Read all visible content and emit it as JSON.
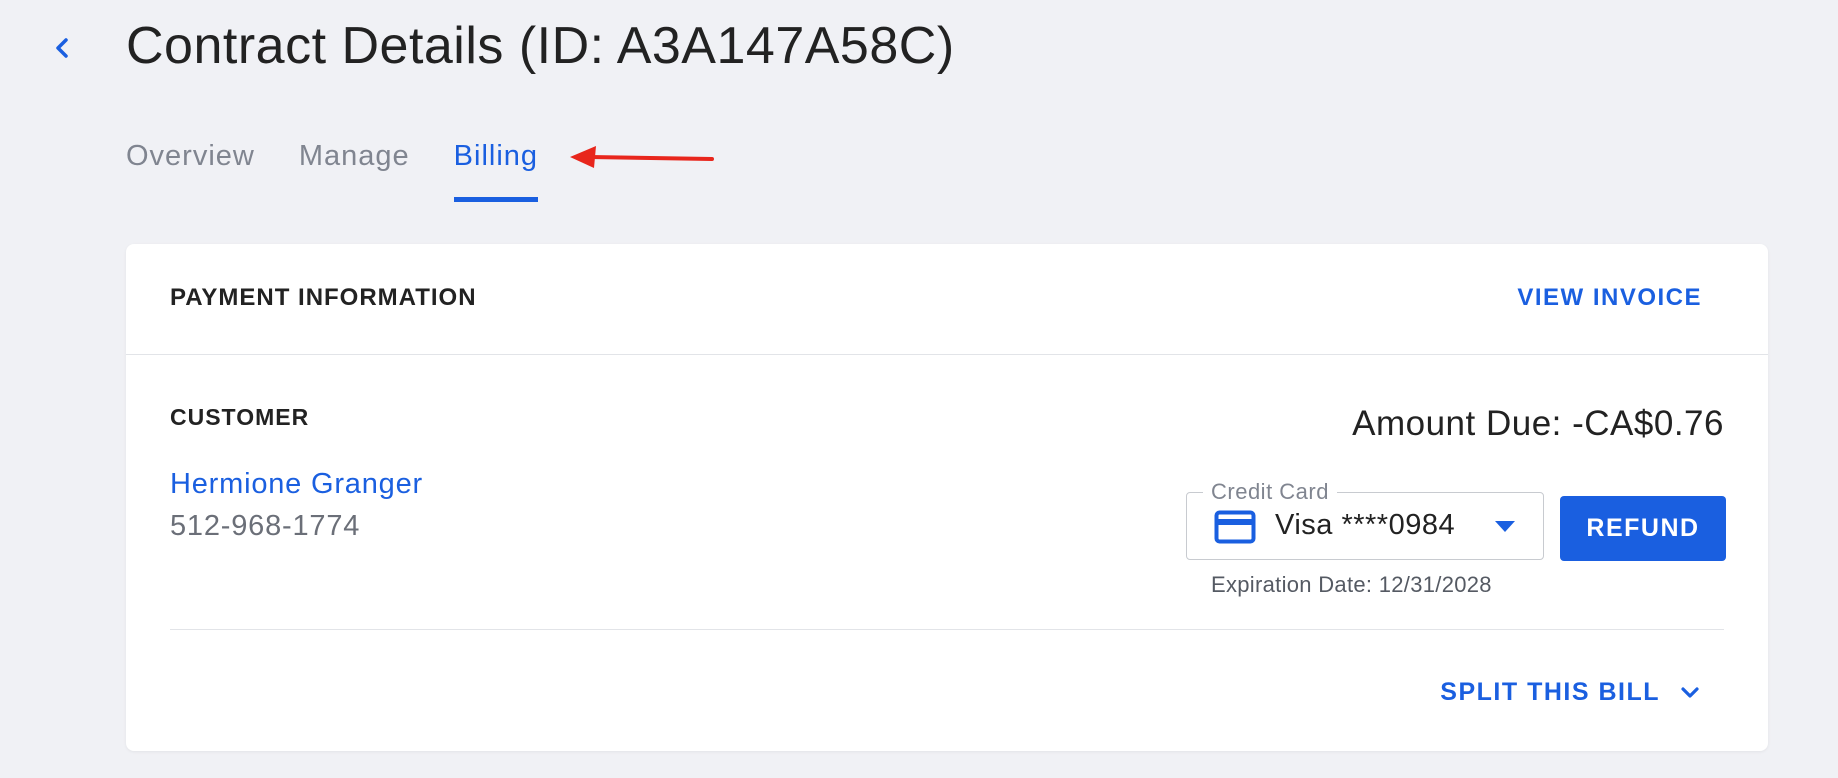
{
  "header": {
    "title": "Contract Details (ID: A3A147A58C)",
    "back_icon": "chevron-left-icon"
  },
  "tabs": [
    {
      "label": "Overview",
      "active": false
    },
    {
      "label": "Manage",
      "active": false
    },
    {
      "label": "Billing",
      "active": true
    }
  ],
  "payment": {
    "section_title": "PAYMENT INFORMATION",
    "view_invoice_label": "VIEW INVOICE",
    "customer": {
      "label": "CUSTOMER",
      "name": "Hermione Granger",
      "phone": "512-968-1774"
    },
    "amount_due": "Amount Due: -CA$0.76",
    "payment_method": {
      "field_label": "Credit Card",
      "selected": "Visa ****0984",
      "icon": "credit-card-icon"
    },
    "expiration": "Expiration Date: 12/31/2028",
    "refund_label": "REFUND",
    "split_bill_label": "SPLIT THIS BILL"
  },
  "colors": {
    "accent": "#1a5fe0",
    "background": "#f0f1f5",
    "annotation": "#e8261c"
  }
}
